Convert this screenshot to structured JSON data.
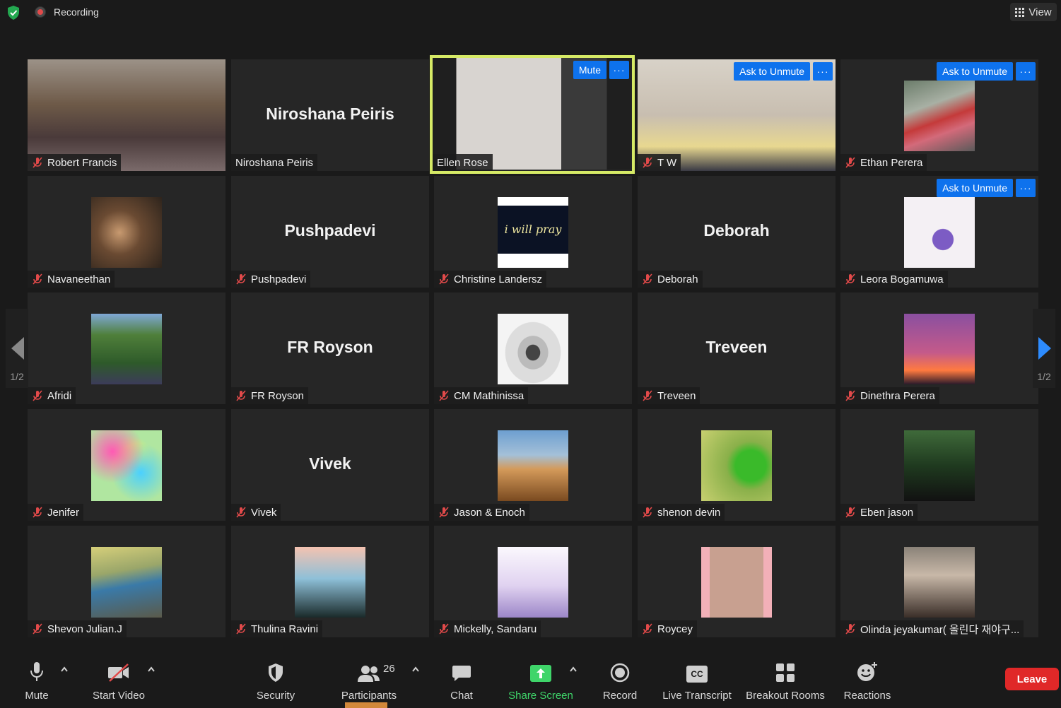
{
  "topbar": {
    "recording_label": "Recording",
    "view_label": "View"
  },
  "colors": {
    "accent_blue": "#0e72ed",
    "active_speaker": "#d6ea66",
    "leave_red": "#e02828",
    "share_green": "#3fd56a"
  },
  "tiles": [
    {
      "name": "Robert Francis",
      "muted": true,
      "kind": "video"
    },
    {
      "name": "Niroshana Peiris",
      "muted": false,
      "kind": "name",
      "big": "Niroshana Peiris"
    },
    {
      "name": "Ellen Rose",
      "muted": false,
      "kind": "video",
      "button": "Mute",
      "active": true
    },
    {
      "name": "T W",
      "muted": true,
      "kind": "video",
      "button": "Ask to Unmute"
    },
    {
      "name": "Ethan Perera",
      "muted": true,
      "kind": "avatar",
      "button": "Ask to Unmute"
    },
    {
      "name": "Navaneethan",
      "muted": true,
      "kind": "avatar"
    },
    {
      "name": "Pushpadevi",
      "muted": true,
      "kind": "name",
      "big": "Pushpadevi"
    },
    {
      "name": "Christine Landersz",
      "muted": true,
      "kind": "avatar",
      "avatar_text": "i will pray"
    },
    {
      "name": "Deborah",
      "muted": true,
      "kind": "name",
      "big": "Deborah"
    },
    {
      "name": "Leora Bogamuwa",
      "muted": true,
      "kind": "avatar",
      "button": "Ask to Unmute"
    },
    {
      "name": "Afridi",
      "muted": true,
      "kind": "avatar"
    },
    {
      "name": "FR Royson",
      "muted": true,
      "kind": "name",
      "big": "FR Royson"
    },
    {
      "name": "CM Mathinissa",
      "muted": true,
      "kind": "avatar"
    },
    {
      "name": "Treveen",
      "muted": true,
      "kind": "name",
      "big": "Treveen"
    },
    {
      "name": "Dinethra Perera",
      "muted": true,
      "kind": "avatar"
    },
    {
      "name": "Jenifer",
      "muted": true,
      "kind": "avatar"
    },
    {
      "name": "Vivek",
      "muted": true,
      "kind": "name",
      "big": "Vivek"
    },
    {
      "name": "Jason & Enoch",
      "muted": true,
      "kind": "avatar"
    },
    {
      "name": "shenon devin",
      "muted": true,
      "kind": "avatar"
    },
    {
      "name": "Eben jason",
      "muted": true,
      "kind": "avatar"
    },
    {
      "name": "Shevon Julian.J",
      "muted": true,
      "kind": "avatar"
    },
    {
      "name": "Thulina Ravini",
      "muted": true,
      "kind": "avatar"
    },
    {
      "name": "Mickelly, Sandaru",
      "muted": true,
      "kind": "avatar"
    },
    {
      "name": "Roycey",
      "muted": true,
      "kind": "avatar"
    },
    {
      "name": "Olinda jeyakumar( 올린다 재야구...",
      "muted": true,
      "kind": "avatar"
    }
  ],
  "tile_more_label": "···",
  "pager": {
    "left": "1/2",
    "right": "1/2"
  },
  "toolbar": {
    "mute": "Mute",
    "start_video": "Start Video",
    "security": "Security",
    "participants": "Participants",
    "participants_count": "26",
    "chat": "Chat",
    "share_screen": "Share Screen",
    "record": "Record",
    "live_transcript": "Live Transcript",
    "cc_badge": "CC",
    "breakout_rooms": "Breakout Rooms",
    "reactions": "Reactions",
    "leave": "Leave"
  }
}
